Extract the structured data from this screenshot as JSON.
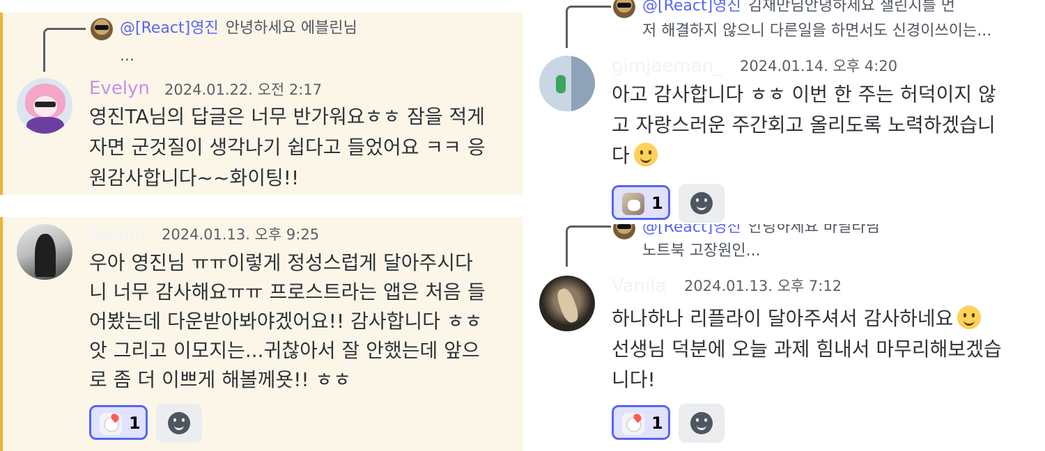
{
  "messages": {
    "evelyn": {
      "reply": {
        "mention": "@[React]영진",
        "text_line1": "안녕하세요 에블린님",
        "text_line2": "..."
      },
      "username": "Evelyn",
      "username_color": "#c690ea",
      "timestamp": "2024.01.22. 오전 2:17",
      "lines": [
        "영진TA님의 답글은 너무 반가워요ㅎㅎ 잠을 적게",
        "자면 군것질이 생각나기 쉽다고 들었어요 ㅋㅋ 응",
        "원감사합니다~~화이팅!!"
      ]
    },
    "sumin": {
      "username": "Sumin",
      "timestamp": "2024.01.13. 오후 9:25",
      "lines": [
        "우아 영진님 ㅠㅠ이렇게 정성스럽게 달아주시다",
        "니 너무 감사해요ㅠㅠ 프로스트라는 앱은 처음 들",
        "어봤는데 다운받아봐야겠어요!! 감사합니다 ㅎㅎ",
        "앗 그리고 이모지는...귀찮아서 잘 안했는데 앞으",
        "로 좀 더 이쁘게 해볼께욧!! ㅎㅎ"
      ],
      "reaction": {
        "emoji": "cat-heart-emoji",
        "count": "1"
      }
    },
    "gimjaeman": {
      "reply": {
        "mention": "@[React]영진",
        "text_line1": "김재만님안녕하세요  챌린지를 먼",
        "text_line2": "저 해결하지 않으니 다른일을 하면서도 신경이쓰이는..."
      },
      "username": "gimjaeman_",
      "timestamp": "2024.01.14. 오후 4:20",
      "lines": [
        "아고 감사합니다 ㅎㅎ 이번 한 주는 허덕이지 않",
        "고 자랑스러운 주간회고 올리도록 노력하겠습니",
        "다"
      ],
      "reaction": {
        "emoji": "cat-photo-emoji",
        "count": "1"
      }
    },
    "vanila": {
      "reply": {
        "mention": "@[React]영진",
        "text_line1": "안녕하세요 바닐라님",
        "text_line2": "노트북 고장원인..."
      },
      "username": "Vanila",
      "timestamp": "2024.01.13. 오후 7:12",
      "lines": [
        "하나하나 리플라이 달아주셔서 감사하네요",
        "선생님 덕분에 오늘 과제 힘내서 마무리해보겠습",
        "니다!"
      ],
      "reaction": {
        "emoji": "cat-heart-emoji",
        "count": "1"
      }
    }
  },
  "colors": {
    "highlight_background": "#fbf6e8",
    "mention_stripe": "#f0b232",
    "mention_text": "#5865f2",
    "reaction_border": "#5865f2",
    "reaction_fill": "#e0e2ff"
  },
  "icons": {
    "add_reaction": "smiley-face-icon",
    "inline_emoji": "slightly-smiling-face-emoji"
  }
}
